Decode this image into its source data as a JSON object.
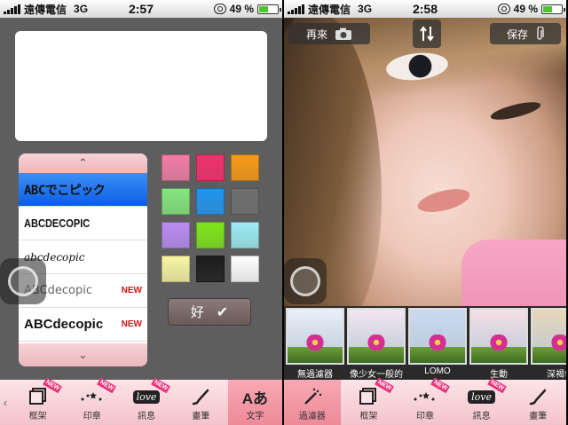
{
  "status_bar": {
    "left": {
      "carrier": "遠傳電信",
      "network": "3G",
      "time": "2:57",
      "battery": "49 %"
    },
    "right": {
      "carrier": "遠傳電信",
      "network": "3G",
      "time": "2:58",
      "battery": "49 %"
    },
    "battery_level": 0.49
  },
  "text_editor": {
    "font_options": [
      {
        "label": "ABCでこピック",
        "selected": true,
        "new": ""
      },
      {
        "label": "ABCDECOPIC",
        "selected": false,
        "new": ""
      },
      {
        "label": "abcdecopic",
        "selected": false,
        "new": ""
      },
      {
        "label": "ABCdecopic",
        "selected": false,
        "new": "NEW"
      },
      {
        "label": "ABCdecopic",
        "selected": false,
        "new": "NEW"
      }
    ],
    "color_swatches": [
      "#f27ca6",
      "#f2306d",
      "#f89a14",
      "#84e57e",
      "#1f95ee",
      "#6e6e6e",
      "#b98bf2",
      "#7ee51a",
      "#9cecf4",
      "#f8f5a2",
      "#1c1c1c",
      "#ffffff"
    ],
    "ok_label": "好",
    "up_arrow": "⌃",
    "down_arrow": "⌄"
  },
  "left_toolbar": {
    "items": [
      {
        "label": "框架",
        "icon": "frame-icon",
        "new": "NEW",
        "active": false
      },
      {
        "label": "印章",
        "icon": "stamp-icon",
        "new": "NEW",
        "active": false
      },
      {
        "label": "訊息",
        "icon": "message-icon",
        "new": "NEW",
        "active": false
      },
      {
        "label": "畫筆",
        "icon": "brush-icon",
        "new": "",
        "active": false
      },
      {
        "label": "文字",
        "icon": "text-icon",
        "new": "",
        "active": true
      }
    ],
    "text_glyph": "Aあ",
    "message_glyph": "love"
  },
  "camera": {
    "retake_label": "再來",
    "save_label": "保存"
  },
  "filters": [
    {
      "label": "無過濾器",
      "tint": "#e8f0f8"
    },
    {
      "label": "像少女一般的",
      "tint": "#f2e6ee"
    },
    {
      "label": "LOMO",
      "tint": "#c9d9f0"
    },
    {
      "label": "生動",
      "tint": "#f6e0e6"
    },
    {
      "label": "深褐色",
      "tint": "#e8d6b8"
    }
  ],
  "right_toolbar": {
    "items": [
      {
        "label": "過濾器",
        "icon": "wand-icon",
        "new": "",
        "active": true
      },
      {
        "label": "框架",
        "icon": "frame-icon",
        "new": "NEW",
        "active": false
      },
      {
        "label": "印章",
        "icon": "stamp-icon",
        "new": "NEW",
        "active": false
      },
      {
        "label": "訊息",
        "icon": "message-icon",
        "new": "NEW",
        "active": false
      },
      {
        "label": "畫筆",
        "icon": "brush-icon",
        "new": "",
        "active": false
      }
    ],
    "message_glyph": "love"
  }
}
